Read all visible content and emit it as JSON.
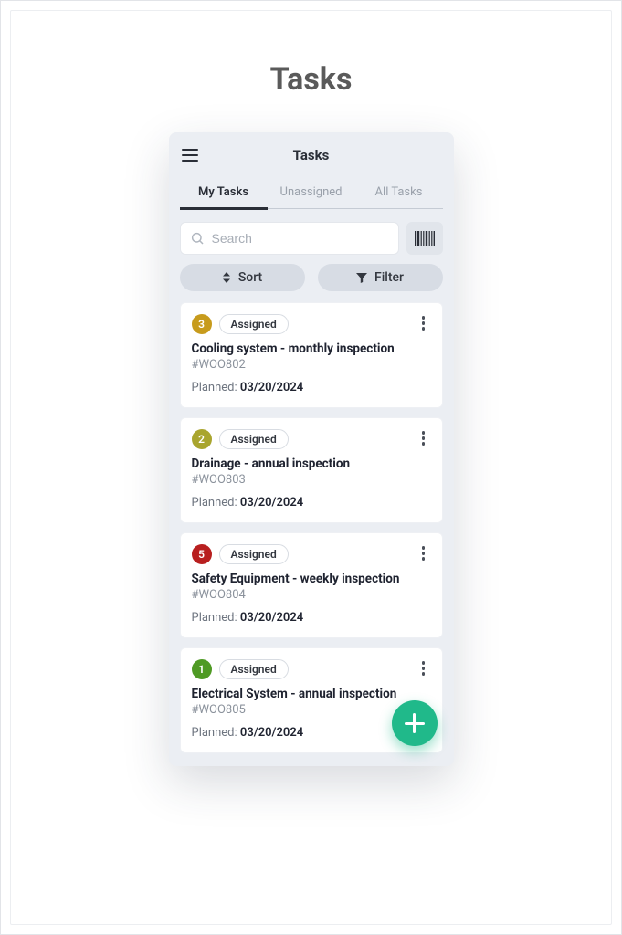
{
  "page_heading": "Tasks",
  "header": {
    "title": "Tasks"
  },
  "tabs": [
    {
      "label": "My Tasks",
      "active": true
    },
    {
      "label": "Unassigned",
      "active": false
    },
    {
      "label": "All Tasks",
      "active": false
    }
  ],
  "search": {
    "placeholder": "Search"
  },
  "controls": {
    "sort_label": "Sort",
    "filter_label": "Filter"
  },
  "colors": {
    "priority_amber": "#c79b1c",
    "priority_olive": "#a9a52e",
    "priority_red": "#b81f1f",
    "priority_green": "#4f9a24",
    "fab": "#20b98a"
  },
  "planned_label": "Planned: ",
  "tasks": [
    {
      "priority": "3",
      "priority_color": "priority_amber",
      "status": "Assigned",
      "title": "Cooling system - monthly inspection",
      "id": "#WOO802",
      "planned_date": "03/20/2024"
    },
    {
      "priority": "2",
      "priority_color": "priority_olive",
      "status": "Assigned",
      "title": "Drainage - annual inspection",
      "id": "#WOO803",
      "planned_date": "03/20/2024"
    },
    {
      "priority": "5",
      "priority_color": "priority_red",
      "status": "Assigned",
      "title": "Safety Equipment - weekly inspection",
      "id": "#WOO804",
      "planned_date": "03/20/2024"
    },
    {
      "priority": "1",
      "priority_color": "priority_green",
      "status": "Assigned",
      "title": "Electrical System - annual inspection",
      "id": "#WOO805",
      "planned_date": "03/20/2024"
    }
  ]
}
